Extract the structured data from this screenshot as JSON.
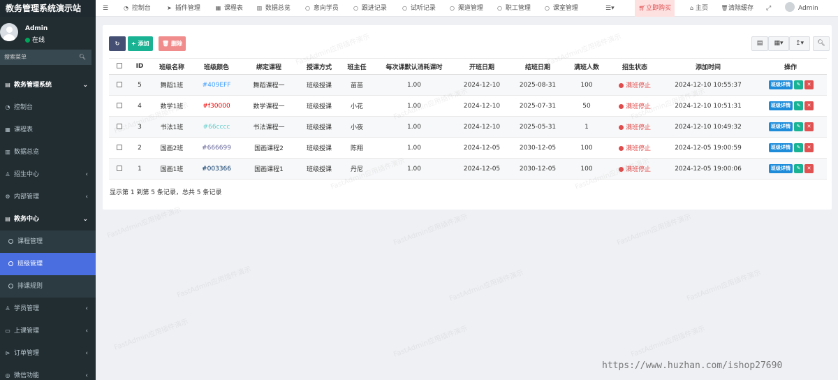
{
  "app": {
    "title": "教务管理系统演示站"
  },
  "user": {
    "name": "Admin",
    "status": "在线"
  },
  "sidebar": {
    "search_placeholder": "搜索菜单",
    "items": [
      {
        "label": "教务管理系统",
        "icon": "book-icon",
        "type": "header",
        "arrow": "expanded"
      },
      {
        "label": "控制台",
        "icon": "dashboard-icon",
        "type": "item"
      },
      {
        "label": "课程表",
        "icon": "calendar-icon",
        "type": "item"
      },
      {
        "label": "数据总览",
        "icon": "chart-icon",
        "type": "item"
      },
      {
        "label": "招生中心",
        "icon": "user-icon",
        "type": "item",
        "arrow": "collapsed"
      },
      {
        "label": "内部管理",
        "icon": "gear-icon",
        "type": "item",
        "arrow": "collapsed"
      },
      {
        "label": "教务中心",
        "icon": "book-icon",
        "type": "header",
        "arrow": "expanded"
      },
      {
        "label": "课程管理",
        "icon": "circle-icon",
        "type": "sub"
      },
      {
        "label": "班级管理",
        "icon": "circle-icon",
        "type": "sub",
        "active": true
      },
      {
        "label": "排课规则",
        "icon": "circle-icon",
        "type": "sub"
      },
      {
        "label": "学员管理",
        "icon": "users-icon",
        "type": "item",
        "arrow": "collapsed"
      },
      {
        "label": "上课管理",
        "icon": "desktop-icon",
        "type": "item",
        "arrow": "collapsed"
      },
      {
        "label": "订单管理",
        "icon": "cart-icon",
        "type": "item",
        "arrow": "collapsed"
      },
      {
        "label": "微信功能",
        "icon": "wechat-icon",
        "type": "item",
        "arrow": "collapsed"
      }
    ]
  },
  "topnav": {
    "menu_toggle_icon": "bars-icon",
    "items": [
      {
        "label": "控制台",
        "icon": "dashboard-icon"
      },
      {
        "label": "插件管理",
        "icon": "rocket-icon"
      },
      {
        "label": "课程表",
        "icon": "calendar-icon"
      },
      {
        "label": "数据总览",
        "icon": "chart-icon"
      },
      {
        "label": "意向学员",
        "icon": "circle-icon"
      },
      {
        "label": "跟进记录",
        "icon": "circle-icon"
      },
      {
        "label": "试听记录",
        "icon": "circle-icon"
      },
      {
        "label": "渠道管理",
        "icon": "circle-icon"
      },
      {
        "label": "职工管理",
        "icon": "circle-icon"
      },
      {
        "label": "课室管理",
        "icon": "circle-icon"
      }
    ],
    "more_icon": "list-dropdown-icon",
    "buy": "立即购买",
    "home": "主页",
    "clear_cache": "清除缓存",
    "fullscreen_icon": "expand-icon",
    "admin": "Admin"
  },
  "toolbar": {
    "refresh_icon": "refresh-icon",
    "add": "添加",
    "delete": "删除"
  },
  "table": {
    "columns": [
      "ID",
      "班级名称",
      "班级颜色",
      "绑定课程",
      "授课方式",
      "班主任",
      "每次课默认消耗课时",
      "开班日期",
      "结班日期",
      "满班人数",
      "招生状态",
      "添加时间",
      "操作"
    ],
    "rows": [
      {
        "id": "5",
        "name": "舞蹈1班",
        "color": "#409EFF",
        "course": "舞蹈课程一",
        "mode": "班级授课",
        "teacher": "苗苗",
        "hours": "1.00",
        "start": "2024-12-10",
        "end": "2025-08-31",
        "capacity": "100",
        "status": "满班停止",
        "added": "2024-12-10 10:55:37"
      },
      {
        "id": "4",
        "name": "数学1班",
        "color": "#f30000",
        "course": "数学课程一",
        "mode": "班级授课",
        "teacher": "小花",
        "hours": "1.00",
        "start": "2024-12-10",
        "end": "2025-07-31",
        "capacity": "50",
        "status": "满班停止",
        "added": "2024-12-10 10:51:31"
      },
      {
        "id": "3",
        "name": "书法1班",
        "color": "#66cccc",
        "course": "书法课程一",
        "mode": "班级授课",
        "teacher": "小夜",
        "hours": "1.00",
        "start": "2024-12-10",
        "end": "2025-05-31",
        "capacity": "1",
        "status": "满班停止",
        "added": "2024-12-10 10:49:32"
      },
      {
        "id": "2",
        "name": "国画2班",
        "color": "#666699",
        "course": "国画课程2",
        "mode": "班级授课",
        "teacher": "陈翔",
        "hours": "1.00",
        "start": "2024-12-05",
        "end": "2030-12-05",
        "capacity": "100",
        "status": "满班停止",
        "added": "2024-12-05 19:00:59"
      },
      {
        "id": "1",
        "name": "国画1班",
        "color": "#003366",
        "course": "国画课程1",
        "mode": "班级授课",
        "teacher": "丹尼",
        "hours": "1.00",
        "start": "2024-12-05",
        "end": "2030-12-05",
        "capacity": "100",
        "status": "满班停止",
        "added": "2024-12-05 19:00:06"
      }
    ],
    "actions": {
      "detail": "班级详情",
      "edit_icon": "pencil-icon",
      "delete_icon": "trash-icon"
    },
    "footer": "显示第 1 到第 5 条记录，总共 5 条记录"
  },
  "watermark": "FastAdmin应用插件演示",
  "source_url": "https://www.huzhan.com/ishop27690",
  "colors": {
    "sidebar": "#222d32",
    "active": "#4a6ee0",
    "add": "#19b393",
    "delete": "#f18c8c",
    "status": "#e04b4b"
  }
}
